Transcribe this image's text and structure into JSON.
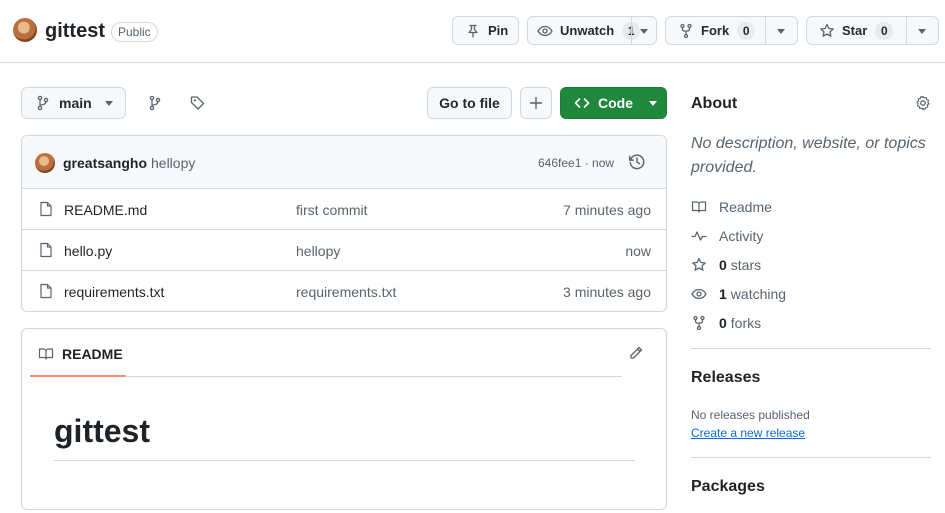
{
  "repo": {
    "name": "gittest",
    "visibility": "Public"
  },
  "header_actions": {
    "pin_label": "Pin",
    "watch_label": "Unwatch",
    "watch_count": "1",
    "fork_label": "Fork",
    "fork_count": "0",
    "star_label": "Star",
    "star_count": "0"
  },
  "toolbar": {
    "branch": "main",
    "go_to_file": "Go to file",
    "code_label": "Code"
  },
  "latest_commit": {
    "author": "greatsangho",
    "message": "hellopy",
    "meta": "646fee1 · now"
  },
  "files": [
    {
      "name": "README.md",
      "commit": "first commit",
      "time": "7 minutes ago"
    },
    {
      "name": "hello.py",
      "commit": "hellopy",
      "time": "now"
    },
    {
      "name": "requirements.txt",
      "commit": "requirements.txt",
      "time": "3 minutes ago"
    }
  ],
  "readme": {
    "tab_label": "README",
    "heading": "gittest"
  },
  "sidebar": {
    "about_title": "About",
    "about_description": "No description, website, or topics provided.",
    "items": [
      {
        "icon": "book-icon",
        "count": "",
        "label": "Readme"
      },
      {
        "icon": "pulse-icon",
        "count": "",
        "label": "Activity"
      },
      {
        "icon": "star-icon",
        "count": "0",
        "label": "stars"
      },
      {
        "icon": "eye-icon",
        "count": "1",
        "label": "watching"
      },
      {
        "icon": "fork-icon",
        "count": "0",
        "label": "forks"
      }
    ],
    "releases_title": "Releases",
    "no_releases": "No releases published",
    "create_release": "Create a new release",
    "packages_title": "Packages"
  },
  "colors": {
    "accent_green": "#1f883d",
    "link_blue": "#0969da",
    "tab_underline": "#fd8c73",
    "border": "#d1d9e0"
  }
}
